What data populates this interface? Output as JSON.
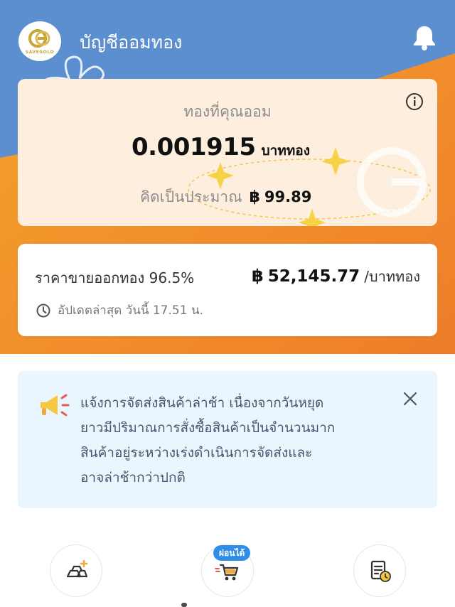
{
  "theme": {
    "header_blue": "#5b8fcf",
    "hero_orange": "#f29a2e",
    "card_cream": "#fdeede",
    "notice_bg": "#eaf6fd",
    "notice_text": "#4a5470",
    "badge_blue": "#2f8fe6",
    "gold": "#c9a53a"
  },
  "header": {
    "logo_alt": "SAVEGOLD",
    "title": "บัญชีออมทอง",
    "bell_icon": "bell-icon"
  },
  "balance": {
    "label": "ทองที่คุณออม",
    "amount": "0.001915",
    "unit": "บาททอง",
    "approx_label": "คิดเป็นประมาณ",
    "currency": "฿",
    "approx_value": "99.89",
    "info_icon": "info-icon"
  },
  "price": {
    "label": "ราคาขายออกทอง 96.5%",
    "currency": "฿",
    "value": "52,145.77",
    "unit": "/บาททอง",
    "updated": "อัปเดตล่าสุด วันนี้ 17.51 น."
  },
  "notice": {
    "lines": [
      "แจ้งการจัดส่งสินค้าล่าช้า เนื่องจากวันหยุด",
      "ยาวมีปริมาณการสั่งซื้อสินค้าเป็นจำนวนมาก",
      "สินค้าอยู่ระหว่างเร่งดำเนินการจัดส่งและ",
      "อาจล่าช้ากว่าปกติ"
    ],
    "icon": "megaphone-icon"
  },
  "actions": {
    "buy_icon": "gold-bar-add-icon",
    "installment_icon": "delivery-cart-icon",
    "installment_badge": "ผ่อนได้",
    "history_icon": "document-clock-icon"
  }
}
